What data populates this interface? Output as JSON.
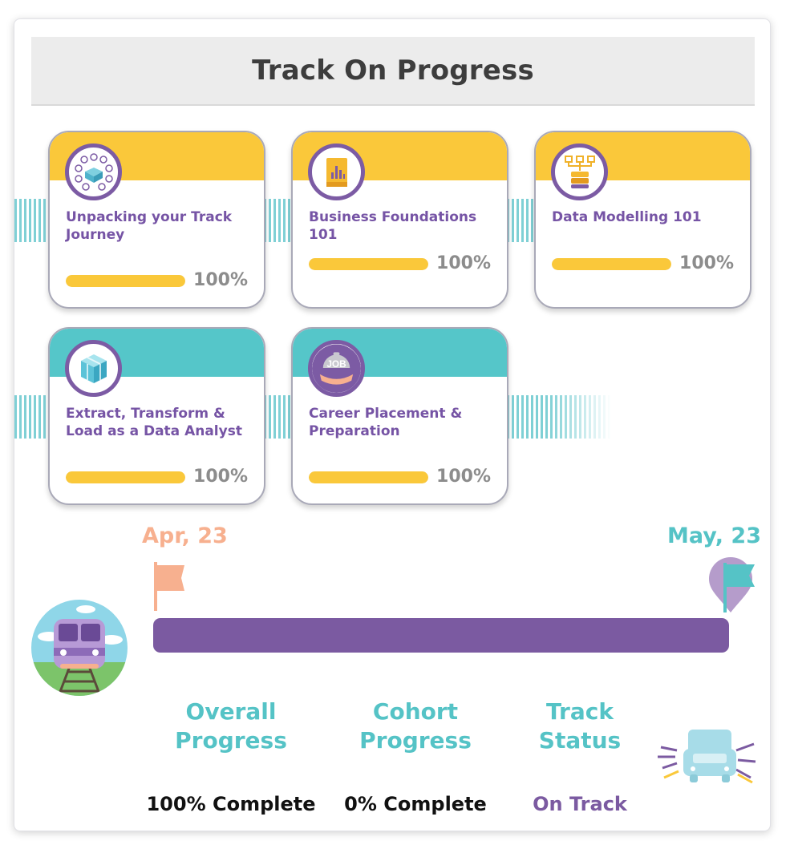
{
  "header": {
    "title": "Track On Progress"
  },
  "modules": [
    {
      "title": "Unpacking your Track Journey",
      "progress": 1.0,
      "percent_label": "100%",
      "color": "#fac83a",
      "icon": "mindmap-icon"
    },
    {
      "title": "Business Foundations 101",
      "progress": 1.0,
      "percent_label": "100%",
      "color": "#fac83a",
      "icon": "book-chart-icon"
    },
    {
      "title": "Data Modelling 101",
      "progress": 1.0,
      "percent_label": "100%",
      "color": "#fac83a",
      "icon": "database-tree-icon"
    },
    {
      "title": "Extract, Transform & Load as a Data Analyst",
      "progress": 1.0,
      "percent_label": "100%",
      "color": "#55c6c9",
      "icon": "cube-icon"
    },
    {
      "title": "Career Placement & Preparation",
      "progress": 1.0,
      "percent_label": "100%",
      "color": "#55c6c9",
      "icon": "job-icon"
    }
  ],
  "timeline": {
    "start_date": "Apr, 23",
    "end_date": "May, 23",
    "start_color": "#f7b08f",
    "end_color": "#55c3c6",
    "bar_color": "#7b5aa1",
    "train_icon": "train-icon",
    "start_flag_icon": "start-flag-icon",
    "end_flag_icon": "end-flag-icon"
  },
  "stats": [
    {
      "title": "Overall Progress",
      "value": "100% Complete",
      "value_color": "#111111"
    },
    {
      "title": "Cohort Progress",
      "value": "0% Complete",
      "value_color": "#111111"
    },
    {
      "title": "Track Status",
      "value": "On Track",
      "value_color": "#7b5aa1"
    }
  ],
  "status_icon": "moving-truck-icon"
}
